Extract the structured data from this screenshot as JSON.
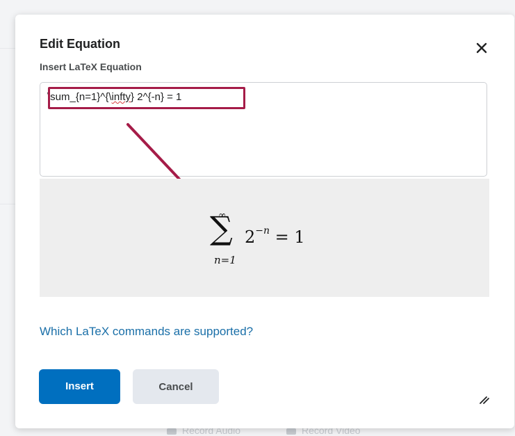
{
  "dialog": {
    "title": "Edit Equation",
    "close_icon": "close-icon",
    "field_label": "Insert LaTeX Equation",
    "latex_value_parts": [
      "\\sum_{n=1}^{\\",
      "infty",
      "} 2^{-n} = 1"
    ],
    "preview": {
      "sum_upper": "∞",
      "sum_symbol": "∑",
      "sum_lower": "n=1",
      "base": "2",
      "exponent": "−n",
      "rhs": "= 1"
    },
    "help_link": "Which LaTeX commands are supported?",
    "insert_label": "Insert",
    "cancel_label": "Cancel",
    "resize_icon": "resize-handle-icon",
    "annotation_color": "#a51c48"
  },
  "background": {
    "record_audio": "Record Audio",
    "record_video": "Record Video"
  }
}
